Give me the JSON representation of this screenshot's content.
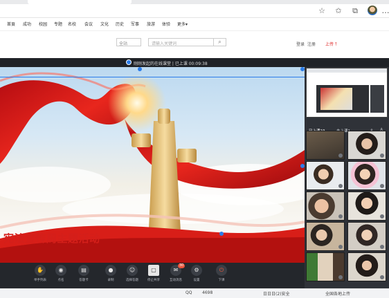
{
  "browser": {
    "avatar": "avatar",
    "icons": [
      "star-outline-icon",
      "favorites-icon",
      "collections-icon",
      "more-icon"
    ]
  },
  "site_nav": {
    "items": [
      "首頁",
      "成功",
      "校园",
      "专题",
      "名校",
      "会议",
      "文化",
      "历史",
      "军事",
      "旅游",
      "体验",
      "更多▾"
    ]
  },
  "search": {
    "scope": "全站",
    "placeholder": "请输入关键词",
    "button_icon": "search-icon"
  },
  "account": {
    "login": "登录",
    "register": "注册",
    "upload": "上传"
  },
  "classroom": {
    "title": "刚刚发起的在线课堂 | 已上课 00:09:38",
    "banner_text": "宪法宣传周主题活动",
    "tabs": [
      "已上课19",
      "未上课1"
    ],
    "controls": [
      {
        "label": "举手列表",
        "icon": "hand-icon"
      },
      {
        "label": "点名",
        "icon": "location-icon"
      },
      {
        "label": "答题卡",
        "icon": "card-icon"
      },
      {
        "label": "录制",
        "icon": "record-icon"
      },
      {
        "label": "选择答题",
        "icon": "select-icon"
      },
      {
        "label": "停止共享",
        "icon": "share-icon",
        "active": true
      },
      {
        "label": "互动消息",
        "icon": "chat-icon",
        "badge": "30"
      },
      {
        "label": "设置",
        "icon": "settings-icon"
      },
      {
        "label": "下课",
        "icon": "power-icon",
        "end": true
      }
    ],
    "accent": "#2b7ce9",
    "end_color": "#f05a3c",
    "banner_color": "#d41f1a"
  },
  "taskbar": {
    "items": [
      "QQ",
      "4698",
      "日日日(2)安全",
      "全国各地上传"
    ]
  }
}
